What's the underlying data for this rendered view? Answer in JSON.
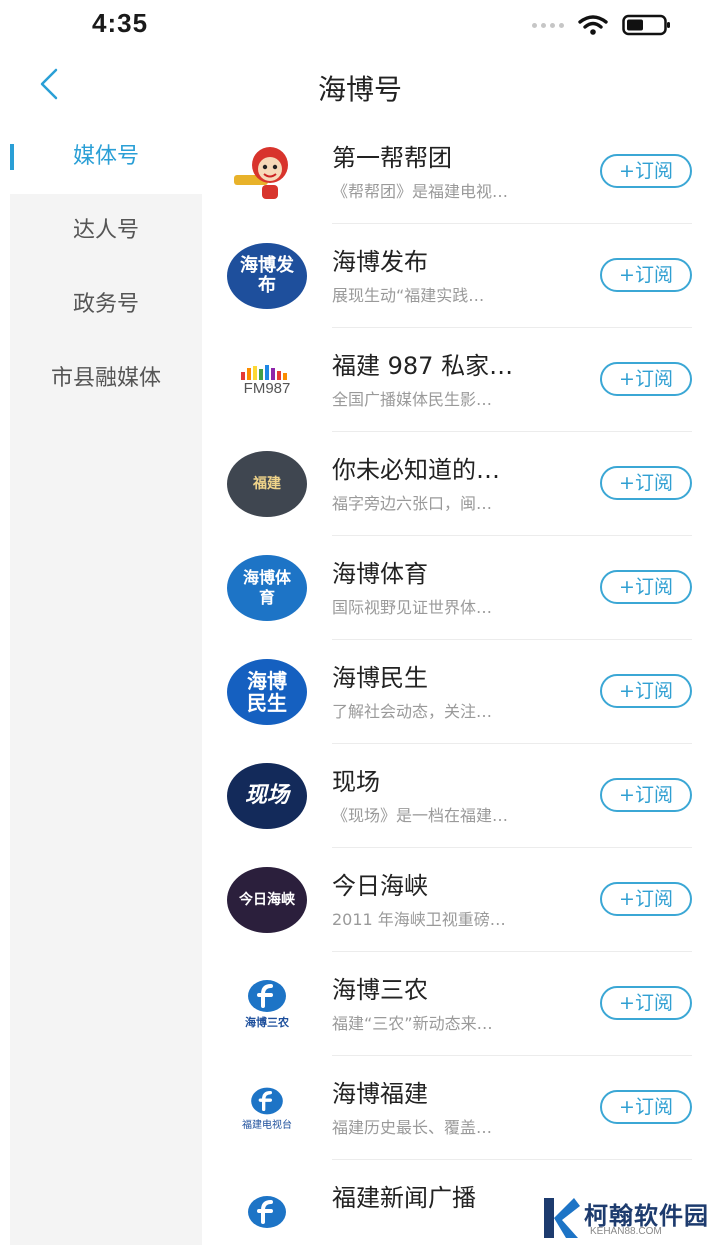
{
  "status": {
    "time": "4:35"
  },
  "nav": {
    "title": "海博号"
  },
  "sidebar": {
    "items": [
      {
        "label": "媒体号"
      },
      {
        "label": "达人号"
      },
      {
        "label": "政务号"
      },
      {
        "label": "市县融媒体"
      }
    ]
  },
  "subscribe_label": "+订阅",
  "rows": [
    {
      "name": "第一帮帮团",
      "desc": "《帮帮团》是福建电视…",
      "logo": "帮"
    },
    {
      "name": "海博发布",
      "desc": "展现生动“福建实践…",
      "logo": "海博发布"
    },
    {
      "name": "福建 987 私家…",
      "desc": "全国广播媒体民生影…",
      "logo": "FM987"
    },
    {
      "name": "你未必知道的…",
      "desc": "福字旁边六张口，闽…",
      "logo": "福建"
    },
    {
      "name": "海博体育",
      "desc": "国际视野见证世界体…",
      "logo": "海博体育"
    },
    {
      "name": "海博民生",
      "desc": "了解社会动态，关注…",
      "logo": "海博民生"
    },
    {
      "name": "现场",
      "desc": "《现场》是一档在福建…",
      "logo": "现场"
    },
    {
      "name": "今日海峡",
      "desc": "2011 年海峡卫视重磅…",
      "logo": "今日海峡"
    },
    {
      "name": "海博三农",
      "desc": "福建“三农”新动态来…",
      "logo": "海博三农"
    },
    {
      "name": "海博福建",
      "desc": "福建历史最长、覆盖…",
      "logo": "福建电视台"
    },
    {
      "name": "福建新闻广播",
      "desc": "",
      "logo": ""
    }
  ],
  "watermark": {
    "text": "柯翰软件园",
    "sub": "KEHAN88.COM"
  },
  "colors": {
    "accent": "#2a9fd6",
    "sidebar_bg": "#f4f4f4"
  }
}
